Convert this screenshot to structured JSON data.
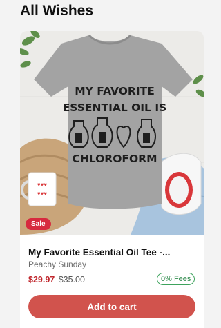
{
  "page": {
    "title": "All Wishes"
  },
  "product": {
    "image_alt": "Gray t-shirt reading MY FAVORITE ESSENTIAL OIL IS CHLOROFORM with bottle illustrations",
    "shirt_text": [
      "MY FAVORITE",
      "ESSENTIAL OIL IS",
      "CHLOROFORM"
    ],
    "badge": "Sale",
    "title": "My Favorite Essential Oil Tee -...",
    "shop": "Peachy Sunday",
    "sale_price": "$29.97",
    "original_price": "$35.00",
    "fees_badge": "0% Fees",
    "cta": "Add to cart"
  },
  "colors": {
    "sale_red": "#c0272d",
    "badge_red": "#d72a3f",
    "fees_green": "#3ea35d",
    "button": "#d1534d"
  }
}
